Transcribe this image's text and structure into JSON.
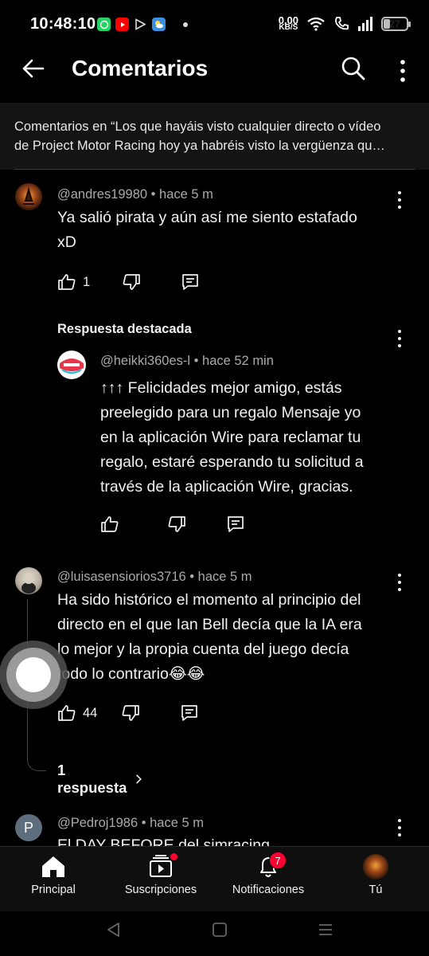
{
  "status_bar": {
    "time": "10:48:10",
    "net_speed_value": "0,00",
    "net_speed_unit": "KB/S",
    "battery": "27",
    "app_icons": [
      "whatsapp-icon",
      "youtube-icon",
      "play-store-icon",
      "weather-icon"
    ]
  },
  "header": {
    "title": "Comentarios"
  },
  "context": {
    "line1": "Comentarios en “Los que hayáis visto cualquier directo o vídeo",
    "line2": "de Project Motor Racing hoy ya habréis visto la vergüenza qu…"
  },
  "comments": [
    {
      "author": "@andres19980",
      "time": "hace 5 m",
      "text_line1": "Ya salió pirata y aún así me siento estafado",
      "text_line2": "xD",
      "likes": "1"
    },
    {
      "author": "@luisasensiorios3716",
      "time": "hace 5 m",
      "text_lines": [
        "Ha sido histórico el momento al principio del",
        "directo en el que Ian Bell decía que la IA era",
        "lo mejor y la propia cuenta del juego decía",
        "todo lo contrario😂😂"
      ],
      "likes": "44",
      "replies": "1 respuesta"
    },
    {
      "author": "@Pedroj1986",
      "time": "hace 5 m",
      "avatar_letter": "P",
      "text_partial": "El DAY BEFORE del simracing"
    }
  ],
  "highlighted_reply": {
    "label": "Respuesta destacada",
    "author": "@heikki360es-l",
    "time": "hace 52 min",
    "text_lines": [
      "↑↑↑ Felicidades mejor amigo, estás",
      "preelegido para un regalo  Mensaje yo",
      "en la aplicación Wire para reclamar tu",
      "regalo, estaré esperando tu solicitud a",
      "través de la aplicación Wire, gracias."
    ]
  },
  "bottom_nav": {
    "items": [
      {
        "label": "Principal",
        "icon": "home-icon"
      },
      {
        "label": "Suscripciones",
        "icon": "subscriptions-icon"
      },
      {
        "label": "Notificaciones",
        "icon": "bell-icon",
        "badge": "7"
      },
      {
        "label": "Tú",
        "icon": "avatar"
      }
    ]
  },
  "colors": {
    "background": "#000000",
    "banner": "#141414",
    "text": "#f1f1f1",
    "meta": "#aaaaaa",
    "badge": "#ff0033"
  }
}
